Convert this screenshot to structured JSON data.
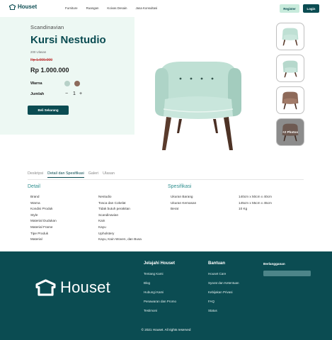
{
  "nav": {
    "brand": "Houset",
    "links": [
      "Furniture",
      "Ruangan",
      "Koivas Desain",
      "Jasa Konsultasi"
    ],
    "register": "Register",
    "login": "Login"
  },
  "product": {
    "category": "Scandinavian",
    "name": "Kursi Nestudio",
    "sold": "200 Ulasan",
    "old_price": "Rp 1.000.000",
    "price": "Rp 1.000.000",
    "color_label": "Warna",
    "colors": [
      "#b7d1c8",
      "#8d6b5c"
    ],
    "qty_label": "Jumlah",
    "qty_minus": "−",
    "qty_value": "1",
    "qty_plus": "+",
    "buy_label": "Beli Sekarang"
  },
  "gallery": {
    "more_label": "+2 Photos"
  },
  "tabs": [
    "Deskripsi",
    "Detail dan Spesifikasi",
    "Galeri",
    "Ulasan"
  ],
  "detail": {
    "title": "Detail",
    "rows": [
      {
        "label": "Brand",
        "value": "Nestudio"
      },
      {
        "label": "Warna",
        "value": "Tosca dan Cokelat"
      },
      {
        "label": "Kondisi Produk",
        "value": "Tidak butuh perakitan"
      },
      {
        "label": "Style",
        "value": "Scandinavian"
      },
      {
        "label": "Material Dudukan",
        "value": "Kain"
      },
      {
        "label": "Material Frame",
        "value": "Kayu"
      },
      {
        "label": "Tipe Produk",
        "value": "Upholstery"
      },
      {
        "label": "Material",
        "value": "Kayu, Kain Woven, dan Busa"
      }
    ]
  },
  "spec": {
    "title": "Spesifikasi",
    "rows": [
      {
        "label": "Ukuran Barang",
        "value": "140cm x 50cm x 40cm"
      },
      {
        "label": "Ukuran Kemasan",
        "value": "145cm x 55cm x 45cm"
      },
      {
        "label": "Berat",
        "value": "10 Kg"
      }
    ]
  },
  "footer": {
    "brand": "Houset",
    "col1_title": "Jelajahi Houset",
    "col1": [
      "Tentang Kami",
      "Blog",
      "Hubungi Kami",
      "Penawaran dan Promo",
      "Testimoni"
    ],
    "col2_title": "Bantuan",
    "col2": [
      "Houset Care",
      "Syarat dan Ketentuan",
      "Kebijakan Privasi",
      "FAQ",
      "Status"
    ],
    "subscribe_title": "Berlangganan",
    "copyright": "© 2021 Houset. All rights reserved"
  },
  "colors": {
    "brand": "#0b4c52",
    "accent_light": "#c8ebdc",
    "panel_bg": "#edf8f3",
    "sale": "#c03838"
  },
  "icons": {
    "logo": "house-logo-icon"
  }
}
